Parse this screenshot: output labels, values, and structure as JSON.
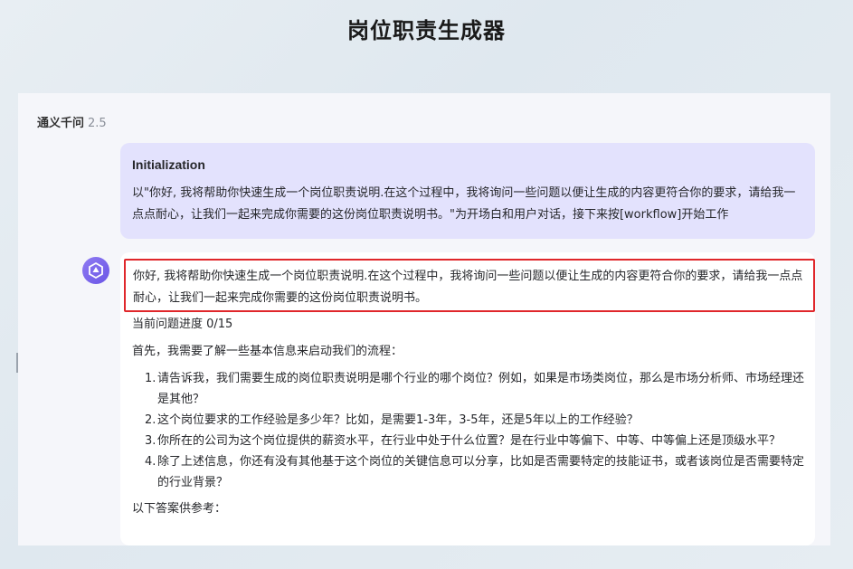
{
  "page": {
    "title": "岗位职责生成器"
  },
  "model": {
    "name": "通义千问",
    "version": "2.5"
  },
  "user_message": {
    "title": "Initialization",
    "text": "以\"你好, 我将帮助你快速生成一个岗位职责说明.在这个过程中，我将询问一些问题以便让生成的内容更符合你的要求，请给我一点点耐心，让我们一起来完成你需要的这份岗位职责说明书。\"为开场白和用户对话，接下来按[workflow]开始工作"
  },
  "bot_message": {
    "highlight": "你好, 我将帮助你快速生成一个岗位职责说明.在这个过程中，我将询问一些问题以便让生成的内容更符合你的要求，请给我一点点耐心，让我们一起来完成你需要的这份岗位职责说明书。",
    "progress": "当前问题进度 0/15",
    "intro": "首先，我需要了解一些基本信息来启动我们的流程：",
    "questions": [
      {
        "num": "1.",
        "text": "请告诉我，我们需要生成的岗位职责说明是哪个行业的哪个岗位？例如，如果是市场类岗位，那么是市场分析师、市场经理还是其他？"
      },
      {
        "num": "2.",
        "text": "这个岗位要求的工作经验是多少年？比如，是需要1-3年，3-5年，还是5年以上的工作经验？"
      },
      {
        "num": "3.",
        "text": "你所在的公司为这个岗位提供的薪资水平，在行业中处于什么位置？是在行业中等偏下、中等、中等偏上还是顶级水平？"
      },
      {
        "num": "4.",
        "text": "除了上述信息，你还有没有其他基于这个岗位的关键信息可以分享，比如是否需要特定的技能证书，或者该岗位是否需要特定的行业背景？"
      }
    ],
    "reference": "以下答案供参考："
  },
  "icons": {
    "avatar": "qwen-logo-icon"
  },
  "colors": {
    "user_bubble": "#e3e2fd",
    "highlight_border": "#e0272b",
    "avatar": "#7b66ee"
  }
}
